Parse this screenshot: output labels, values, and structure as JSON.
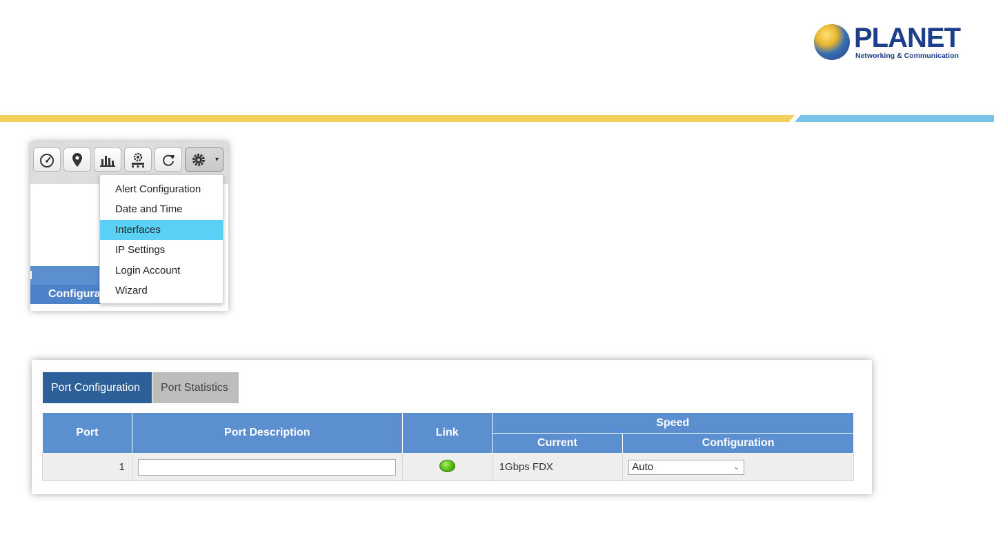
{
  "brand": {
    "name": "PLANET",
    "tagline": "Networking & Communication",
    "colors": {
      "stripe_yellow": "#f3cf5b",
      "stripe_blue": "#79c3e6",
      "header_blue": "#5b8fd0",
      "tab_active": "#2d5f99"
    }
  },
  "toolbar": {
    "buttons": [
      {
        "icon": "dashboard-icon",
        "glyph": "◔"
      },
      {
        "icon": "location-pin-icon",
        "glyph": "⚲"
      },
      {
        "icon": "bar-chart-icon",
        "glyph": "▮"
      },
      {
        "icon": "network-gear-icon",
        "glyph": "⚙"
      },
      {
        "icon": "refresh-icon",
        "glyph": "⟳"
      },
      {
        "icon": "settings-gear-icon",
        "glyph": "⚙"
      }
    ],
    "caret": "▾"
  },
  "background_panel": {
    "partial_header": "Configura"
  },
  "settings_menu": {
    "items": [
      {
        "label": "Alert Configuration",
        "selected": false
      },
      {
        "label": "Date and Time",
        "selected": false
      },
      {
        "label": "Interfaces",
        "selected": true
      },
      {
        "label": "IP Settings",
        "selected": false
      },
      {
        "label": "Login Account",
        "selected": false
      },
      {
        "label": "Wizard",
        "selected": false
      }
    ]
  },
  "port_panel": {
    "tabs": [
      {
        "label": "Port Configuration",
        "active": true
      },
      {
        "label": "Port Statistics",
        "active": false
      }
    ],
    "table": {
      "headers": {
        "port": "Port",
        "description": "Port Description",
        "link": "Link",
        "speed": "Speed",
        "current": "Current",
        "configuration": "Configuration"
      },
      "rows": [
        {
          "port": "1",
          "description": "",
          "link_status": "up",
          "current": "1Gbps FDX",
          "configuration": "Auto"
        }
      ]
    }
  }
}
